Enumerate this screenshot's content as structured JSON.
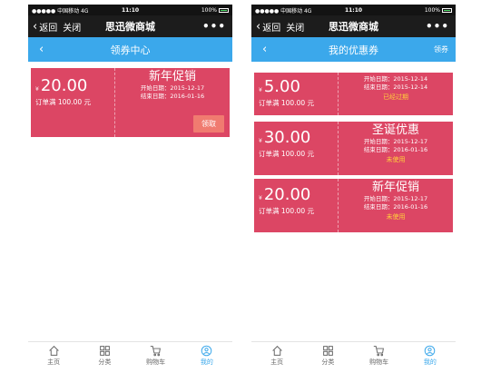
{
  "colors": {
    "header": "#3ba8eb",
    "coupon": "#dc4664",
    "status_text": "#ffd03b",
    "get_button": "#f07b70",
    "active_tab": "#3ba8eb"
  },
  "status_bar": {
    "carrier": "●●●●● 中国移动  4G",
    "time": "11:10",
    "battery": "100%"
  },
  "wechat": {
    "back": "返回",
    "close": "关闭",
    "title": "思迅微商城",
    "more": "•••"
  },
  "left_screen": {
    "title": "领券中心",
    "coupons": [
      {
        "yen": "¥",
        "amount": "20.00",
        "condition": "订单满 100.00 元",
        "title": "新年促销",
        "start": "开始日期：2015-12-17",
        "end": "结束日期：2016-01-16",
        "button": "领取"
      }
    ]
  },
  "right_screen": {
    "title": "我的优惠券",
    "header_link": "领券",
    "coupons": [
      {
        "yen": "¥",
        "amount": "5.00",
        "condition": "订单满 100.00 元",
        "title": "",
        "start": "开始日期：2015-12-14",
        "end": "结束日期：2015-12-14",
        "status": "已经过期"
      },
      {
        "yen": "¥",
        "amount": "30.00",
        "condition": "订单满 100.00 元",
        "title": "圣诞优惠",
        "start": "开始日期：2015-12-17",
        "end": "结束日期：2016-01-16",
        "status": "未使用"
      },
      {
        "yen": "¥",
        "amount": "20.00",
        "condition": "订单满 100.00 元",
        "title": "新年促销",
        "start": "开始日期：2015-12-17",
        "end": "结束日期：2016-01-16",
        "status": "未使用"
      }
    ]
  },
  "tabbar": [
    {
      "label": "主页",
      "icon": "home-icon"
    },
    {
      "label": "分类",
      "icon": "category-icon"
    },
    {
      "label": "购物车",
      "icon": "cart-icon"
    },
    {
      "label": "我的",
      "icon": "user-icon",
      "active": true
    }
  ]
}
